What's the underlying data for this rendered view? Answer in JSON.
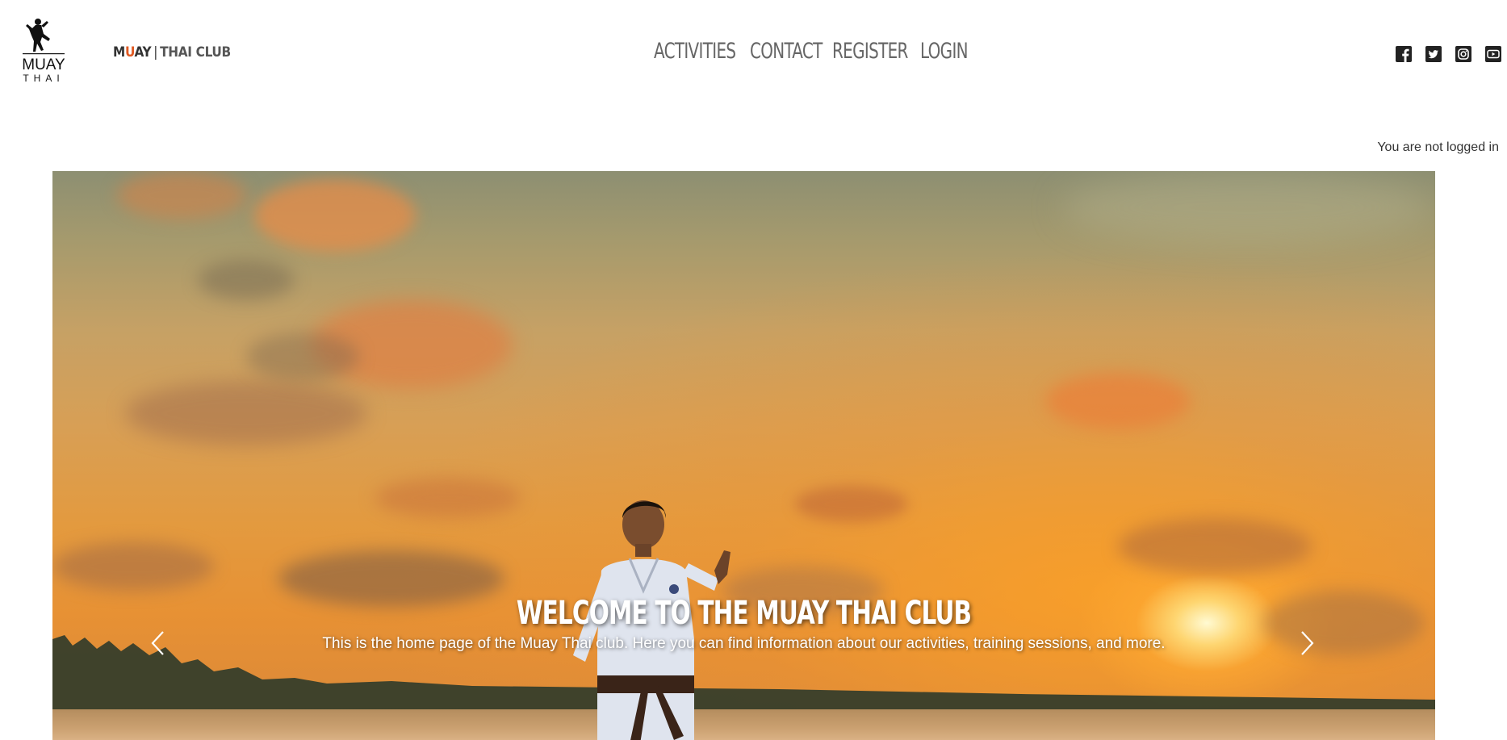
{
  "header": {
    "logo_text_top": "MUAY",
    "logo_text_bottom": "THAI",
    "brand": {
      "m": "M",
      "u": "U",
      "ay": "AY",
      "separator": "|",
      "rest": "THAI CLUB"
    },
    "nav": [
      {
        "label": "ACTIVITIES"
      },
      {
        "label": "CONTACT"
      },
      {
        "label": "REGISTER"
      },
      {
        "label": "LOGIN"
      }
    ],
    "social": [
      {
        "icon": "facebook-icon"
      },
      {
        "icon": "twitter-icon"
      },
      {
        "icon": "instagram-icon"
      },
      {
        "icon": "youtube-icon"
      }
    ]
  },
  "login_status": "You are not logged in",
  "carousel": {
    "slide": {
      "title": "WELCOME TO THE MUAY THAI CLUB",
      "text": "This is the home page of the Muay Thai club. Here you can find information about our activities, training sessions, and more."
    },
    "prev_icon": "chevron-left-icon",
    "next_icon": "chevron-right-icon"
  },
  "colors": {
    "accent": "#e05a23",
    "nav_text": "#666666",
    "icon": "#222222"
  }
}
